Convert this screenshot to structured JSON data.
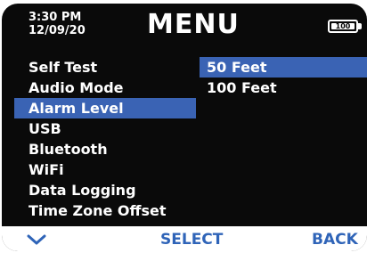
{
  "header": {
    "time": "3:30 PM",
    "date": "12/09/20",
    "title": "MENU",
    "battery_level": "100"
  },
  "menu": {
    "items": [
      {
        "label": "Self Test",
        "selected": false
      },
      {
        "label": "Audio Mode",
        "selected": false
      },
      {
        "label": "Alarm Level",
        "selected": true
      },
      {
        "label": "USB",
        "selected": false
      },
      {
        "label": "Bluetooth",
        "selected": false
      },
      {
        "label": "WiFi",
        "selected": false
      },
      {
        "label": "Data Logging",
        "selected": false
      },
      {
        "label": "Time Zone Offset",
        "selected": false
      }
    ]
  },
  "submenu": {
    "items": [
      {
        "label": "50 Feet",
        "selected": true
      },
      {
        "label": "100 Feet",
        "selected": false
      }
    ]
  },
  "footer": {
    "down_icon": "chevron-down-icon",
    "select_label": "SELECT",
    "back_label": "BACK"
  },
  "colors": {
    "background": "#0a0a0a",
    "highlight": "#3a63b4",
    "footer_text": "#2f64b8",
    "footer_bg": "#ffffff"
  }
}
